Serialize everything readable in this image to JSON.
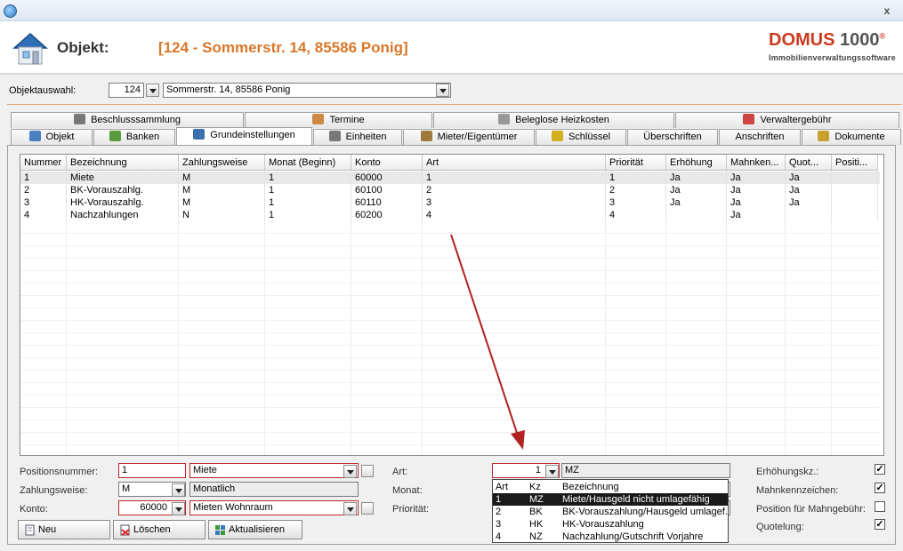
{
  "header": {
    "object_label": "Objekt:",
    "object_value": "[124 - Sommerstr. 14, 85586 Ponig]",
    "logo_main": "DOMUS",
    "logo_number": "1000",
    "logo_reg": "®",
    "logo_sub": "Immobilienverwaltungssoftware",
    "close_symbol": "x"
  },
  "selection": {
    "label": "Objektauswahl:",
    "number": "124",
    "address": "Sommerstr. 14, 85586 Ponig"
  },
  "tabs_top": [
    {
      "label": "Beschlusssammlung",
      "icon": "book-icon"
    },
    {
      "label": "Termine",
      "icon": "calendar-icon"
    },
    {
      "label": "Beleglose Heizkosten",
      "icon": "tag-icon"
    },
    {
      "label": "Verwaltergebühr",
      "icon": "checklist-icon"
    }
  ],
  "tabs_bottom": [
    {
      "label": "Objekt",
      "icon": "house-icon"
    },
    {
      "label": "Banken",
      "icon": "money-icon"
    },
    {
      "label": "Grundeinstellungen",
      "icon": "settings-grid-icon"
    },
    {
      "label": "Einheiten",
      "icon": "units-icon"
    },
    {
      "label": "Mieter/Eigentümer",
      "icon": "people-icon"
    },
    {
      "label": "Schlüssel",
      "icon": "key-icon"
    },
    {
      "label": "Überschriften"
    },
    {
      "label": "Anschriften"
    },
    {
      "label": "Dokumente",
      "icon": "documents-icon"
    }
  ],
  "active_tab": "Grundeinstellungen",
  "grid": {
    "columns": [
      "Nummer",
      "Bezeichnung",
      "Zahlungsweise",
      "Monat (Beginn)",
      "Konto",
      "Art",
      "Priorität",
      "Erhöhung",
      "Mahnken...",
      "Quot...",
      "Positi..."
    ],
    "rows": [
      [
        "1",
        "Miete",
        "M",
        "1",
        "60000",
        "1",
        "1",
        "Ja",
        "Ja",
        "Ja",
        ""
      ],
      [
        "2",
        "BK-Vorauszahlg.",
        "M",
        "1",
        "60100",
        "2",
        "2",
        "Ja",
        "Ja",
        "Ja",
        ""
      ],
      [
        "3",
        "HK-Vorauszahlg.",
        "M",
        "1",
        "60110",
        "3",
        "3",
        "Ja",
        "Ja",
        "Ja",
        ""
      ],
      [
        "4",
        "Nachzahlungen",
        "N",
        "1",
        "60200",
        "4",
        "4",
        "",
        "Ja",
        "",
        ""
      ]
    ]
  },
  "form": {
    "positionsnummer_label": "Positionsnummer:",
    "positionsnummer_value": "1",
    "bezeichnung_value": "Miete",
    "zahlungsweise_label": "Zahlungsweise:",
    "zahlungsweise_value": "M",
    "zahlungsweise_text": "Monatlich",
    "konto_label": "Konto:",
    "konto_value": "60000",
    "konto_text": "Mieten Wohnraum",
    "art_label": "Art:",
    "art_value": "1",
    "art_kz": "MZ",
    "monat_label": "Monat:",
    "prioritaet_label": "Priorität:",
    "erhoehung_label": "Erhöhungskz.:",
    "mahnkennzeichen_label": "Mahnkennzeichen:",
    "position_mahngebuehr_label": "Position für Mahngebühr:",
    "quotelung_label": "Quotelung:",
    "erhoehung_checked": true,
    "mahnkennzeichen_checked": true,
    "position_mahngebuehr_checked": false,
    "quotelung_checked": true,
    "check_symbol": "✓"
  },
  "buttons": {
    "neu": "Neu",
    "loeschen": "Löschen",
    "aktualisieren": "Aktualisieren"
  },
  "art_popup": {
    "headers": [
      "Art",
      "Kz",
      "Bezeichnung"
    ],
    "rows": [
      [
        "1",
        "MZ",
        "Miete/Hausgeld nicht umlagefähig"
      ],
      [
        "2",
        "BK",
        "BK-Vorauszahlung/Hausgeld umlagef."
      ],
      [
        "3",
        "HK",
        "HK-Vorauszahlung"
      ],
      [
        "4",
        "NZ",
        "Nachzahlung/Gutschrift Vorjahre"
      ]
    ],
    "selected_index": 0
  },
  "colors": {
    "accent_orange": "#d9772a",
    "logo_red": "#cc3a1f",
    "invalid_red": "#c0262c",
    "arrow_red": "#b22222"
  }
}
